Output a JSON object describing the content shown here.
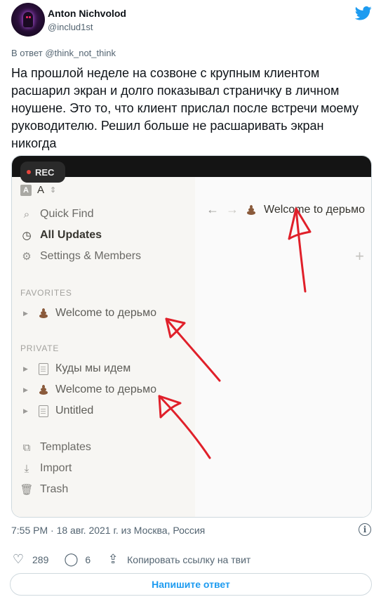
{
  "author": {
    "name": "Anton Nichvolod",
    "handle": "@includ1st"
  },
  "reply_to": {
    "prefix": "В ответ",
    "handle": "@think_not_think"
  },
  "tweet_text": "На прошлой неделе на созвоне с крупным клиентом расшарил экран и долго показывал страничку в личном ноушене. Это то, что клиент прислал после встречи моему руководителю. Решил больше не расшаривать экран никогда",
  "screenshot": {
    "rec_label": "REC",
    "workspace": {
      "icon_letter": "A",
      "name": "A"
    },
    "menu": [
      {
        "label": "Quick Find",
        "icon": "search-icon"
      },
      {
        "label": "All Updates",
        "icon": "clock-icon"
      },
      {
        "label": "Settings & Members",
        "icon": "gear-icon"
      }
    ],
    "favorites_label": "FAVORITES",
    "favorites": [
      {
        "label": "Welcome to дерьмо",
        "icon": "poop-emoji-icon"
      }
    ],
    "private_label": "PRIVATE",
    "private": [
      {
        "label": "Куды мы идем",
        "icon": "document-icon"
      },
      {
        "label": "Welcome to дерьмо",
        "icon": "poop-emoji-icon"
      },
      {
        "label": "Untitled",
        "icon": "document-icon"
      }
    ],
    "bottom_menu": [
      {
        "label": "Templates",
        "icon": "templates-icon"
      },
      {
        "label": "Import",
        "icon": "download-icon"
      },
      {
        "label": "Trash",
        "icon": "trash-icon"
      }
    ],
    "page_title": "Welcome to дерьмо",
    "annotation_color": "#e0202a"
  },
  "meta": "7:55 PM · 18 авг. 2021 г. из Москва, Россия",
  "actions": {
    "likes": "289",
    "replies": "6",
    "share_label": "Копировать ссылку на твит"
  },
  "reply_button": "Напишите ответ",
  "colors": {
    "accent": "#1d9bf0",
    "notion_sidebar": "#f7f6f3"
  }
}
